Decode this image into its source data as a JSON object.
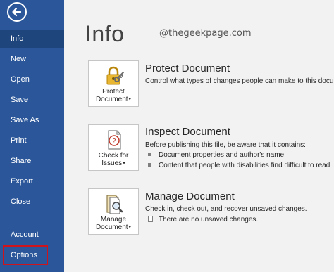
{
  "sidebar": {
    "items": [
      {
        "label": "Info"
      },
      {
        "label": "New"
      },
      {
        "label": "Open"
      },
      {
        "label": "Save"
      },
      {
        "label": "Save As"
      },
      {
        "label": "Print"
      },
      {
        "label": "Share"
      },
      {
        "label": "Export"
      },
      {
        "label": "Close"
      },
      {
        "label": "Account"
      },
      {
        "label": "Options"
      }
    ]
  },
  "page": {
    "title": "Info",
    "watermark": "@thegeekpage.com"
  },
  "sections": {
    "protect": {
      "button_line1": "Protect",
      "button_line2": "Document",
      "title": "Protect Document",
      "desc": "Control what types of changes people can make to this document"
    },
    "inspect": {
      "button_line1": "Check for",
      "button_line2": "Issues",
      "title": "Inspect Document",
      "desc": "Before publishing this file, be aware that it contains:",
      "bullets": [
        "Document properties and author's name",
        "Content that people with disabilities find difficult to read"
      ]
    },
    "manage": {
      "button_line1": "Manage",
      "button_line2": "Document",
      "title": "Manage Document",
      "desc": "Check in, check out, and recover unsaved changes.",
      "note": "There are no unsaved changes."
    }
  },
  "colors": {
    "sidebar": "#2b579a",
    "sidebar_active": "#1f467c",
    "highlight_box": "#d0141c",
    "background": "#f2f2f2"
  }
}
